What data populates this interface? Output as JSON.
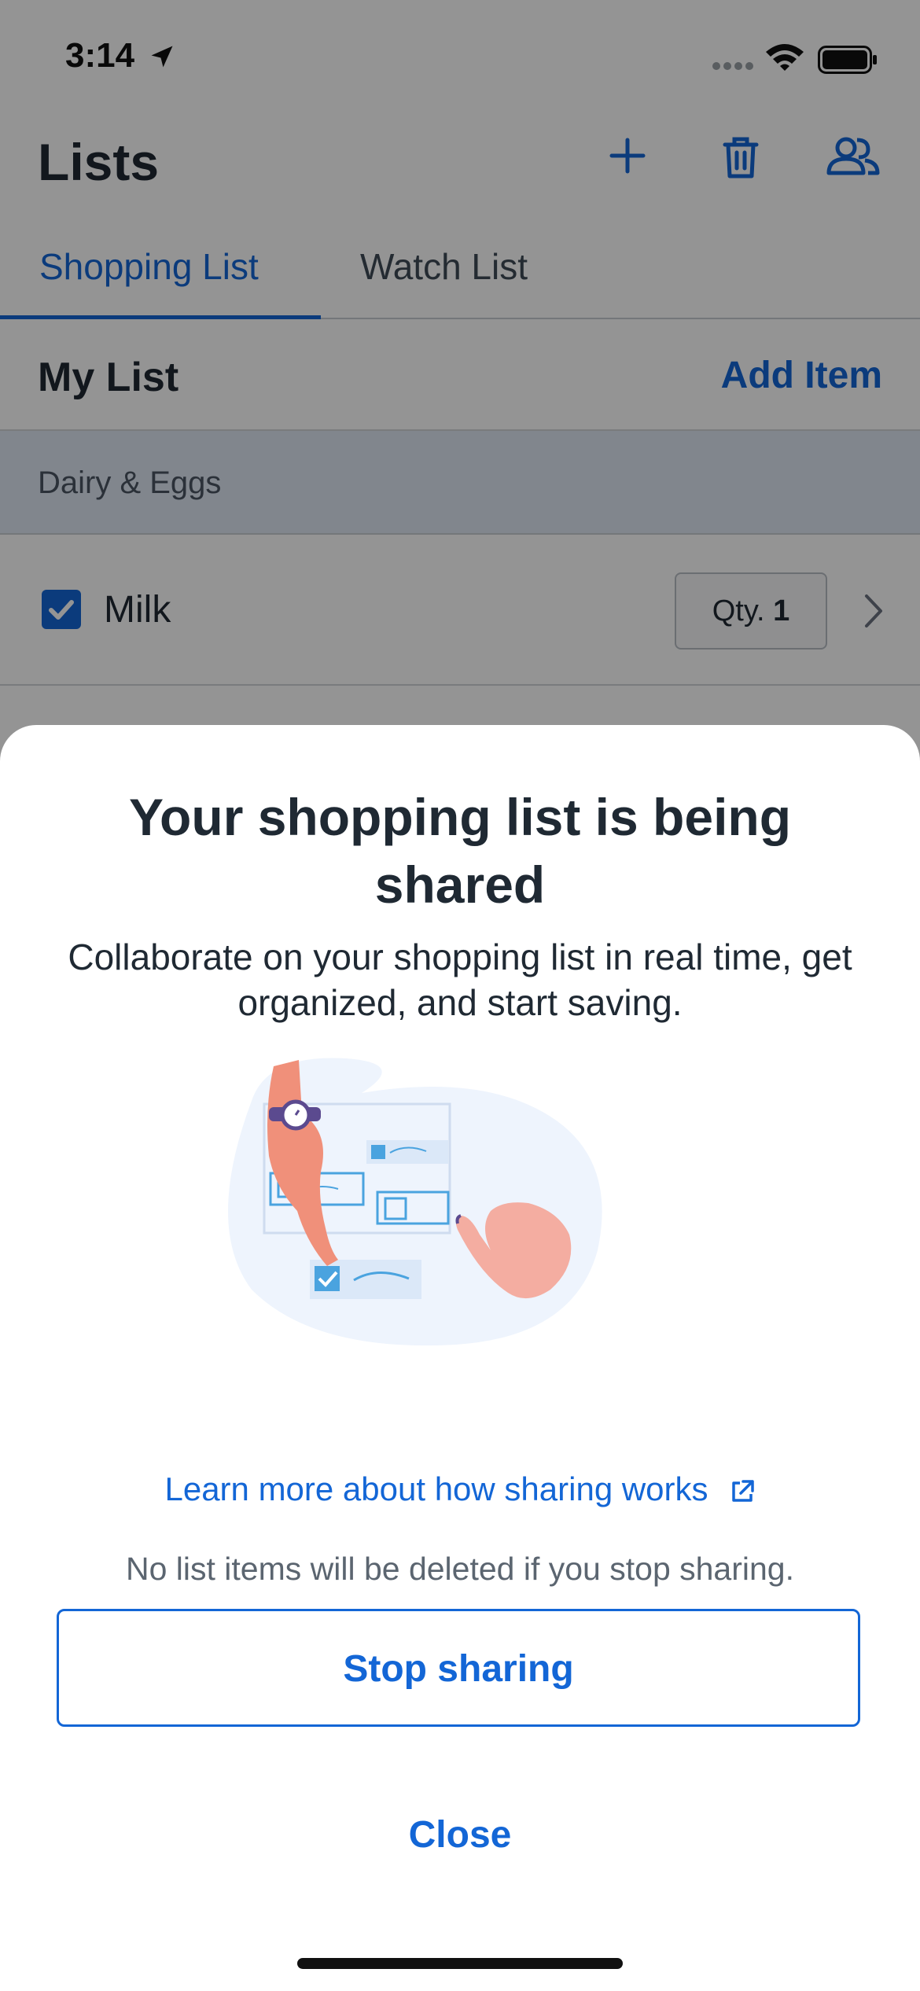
{
  "status_bar": {
    "time": "3:14"
  },
  "header": {
    "title": "Lists"
  },
  "tabs": [
    {
      "label": "Shopping List",
      "active": true
    },
    {
      "label": "Watch List",
      "active": false
    }
  ],
  "list_header": {
    "title": "My List",
    "add_item_label": "Add Item"
  },
  "category": {
    "label": "Dairy & Eggs"
  },
  "items": [
    {
      "name": "Milk",
      "checked": true,
      "qty_label": "Qty.",
      "qty_value": "1"
    }
  ],
  "sheet": {
    "title": "Your shopping list is being shared",
    "subtitle": "Collaborate on your shopping list in real time, get organized, and start saving.",
    "learn_more_link": "Learn more about how sharing works",
    "note": "No list items will be deleted if you stop sharing.",
    "stop_sharing_label": "Stop sharing",
    "close_label": "Close"
  },
  "colors": {
    "accent": "#1366d6",
    "text": "#1f2933",
    "muted": "#5b6570",
    "category_bg": "#dfe7f3"
  },
  "icons": [
    "location-arrow-icon",
    "signal-icon",
    "wifi-icon",
    "battery-icon",
    "plus-icon",
    "trash-icon",
    "people-icon",
    "check-icon",
    "chevron-right-icon",
    "external-link-icon"
  ]
}
